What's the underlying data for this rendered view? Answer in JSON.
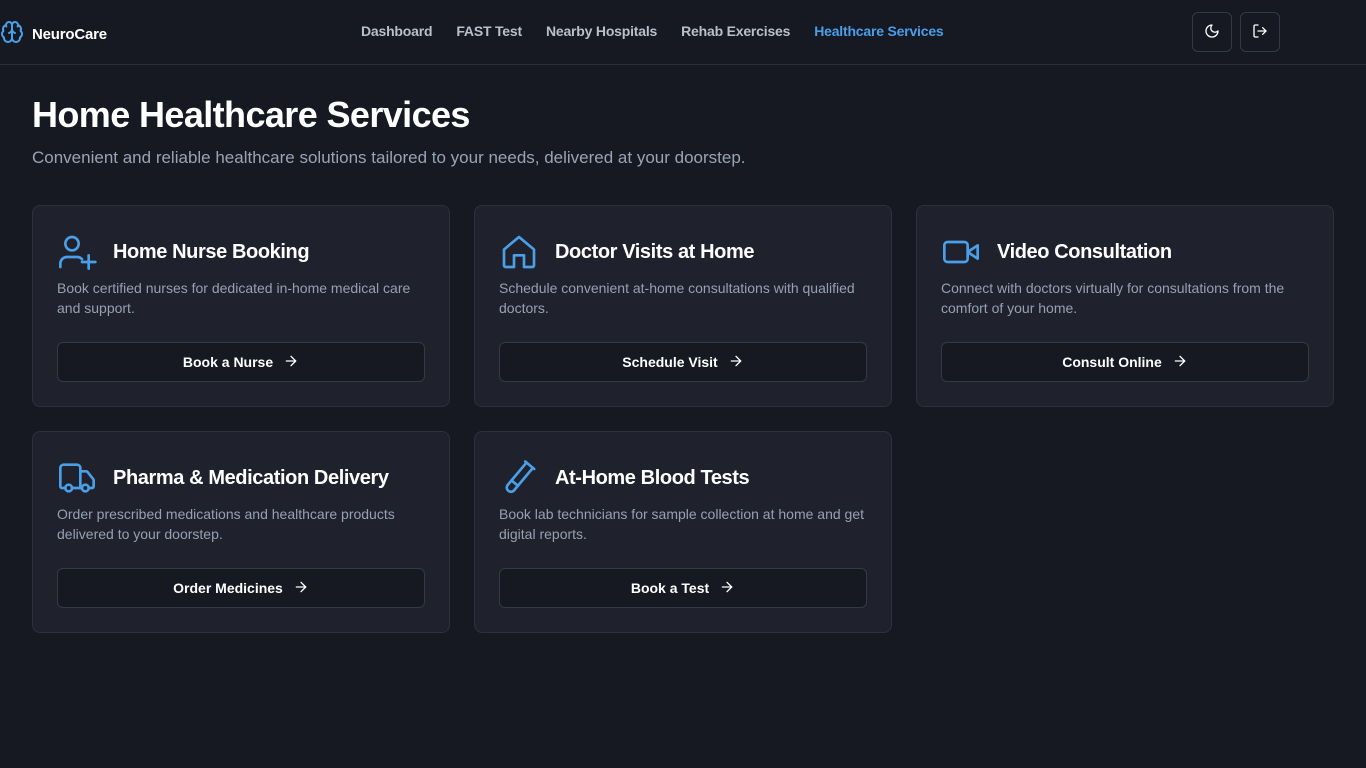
{
  "app": {
    "name": "NeuroCare",
    "logo_icon": "brain-icon",
    "accent_color": "#4a9fe8"
  },
  "nav": {
    "items": [
      {
        "label": "Dashboard",
        "active": false
      },
      {
        "label": "FAST Test",
        "active": false
      },
      {
        "label": "Nearby Hospitals",
        "active": false
      },
      {
        "label": "Rehab Exercises",
        "active": false
      },
      {
        "label": "Healthcare Services",
        "active": true
      }
    ]
  },
  "header_actions": {
    "theme_icon": "moon-icon",
    "logout_icon": "logout-icon"
  },
  "page": {
    "title": "Home Healthcare Services",
    "subtitle": "Convenient and reliable healthcare solutions tailored to your needs, delivered at your doorstep."
  },
  "services": [
    {
      "icon": "user-plus-icon",
      "title": "Home Nurse Booking",
      "description": "Book certified nurses for dedicated in-home medical care and support.",
      "button": "Book a Nurse"
    },
    {
      "icon": "home-icon",
      "title": "Doctor Visits at Home",
      "description": "Schedule convenient at-home consultations with qualified doctors.",
      "button": "Schedule Visit"
    },
    {
      "icon": "video-icon",
      "title": "Video Consultation",
      "description": "Connect with doctors virtually for consultations from the comfort of your home.",
      "button": "Consult Online"
    },
    {
      "icon": "truck-icon",
      "title": "Pharma & Medication Delivery",
      "description": "Order prescribed medications and healthcare products delivered to your doorstep.",
      "button": "Order Medicines"
    },
    {
      "icon": "test-tube-icon",
      "title": "At-Home Blood Tests",
      "description": "Book lab technicians for sample collection at home and get digital reports.",
      "button": "Book a Test"
    }
  ]
}
